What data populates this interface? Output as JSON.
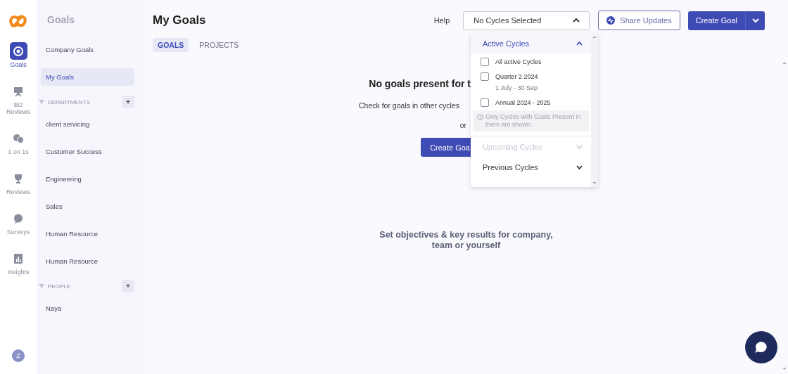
{
  "rail": {
    "items": [
      {
        "kind": "target",
        "label": "Goals",
        "selected": true
      },
      {
        "kind": "easel",
        "label": "Biz Reviews",
        "selected": false
      },
      {
        "kind": "chat",
        "label": "1 on 1s",
        "selected": false
      },
      {
        "kind": "trophy",
        "label": "Reviews",
        "selected": false
      },
      {
        "kind": "bubble",
        "label": "Surveys",
        "selected": false
      },
      {
        "kind": "chart",
        "label": "Insights",
        "selected": false
      }
    ],
    "avatar": "Z"
  },
  "sidebar": {
    "title": "Goals",
    "items": [
      {
        "label": "Company Goals",
        "selected": false
      },
      {
        "label": "My Goals",
        "selected": true
      }
    ],
    "sections": [
      {
        "title": "DEPARTMENTS",
        "add": "+",
        "expanded": true,
        "items": [
          "client servicing",
          "Customer Success",
          "Engineering",
          "Sales",
          "Human Resource",
          "Human Resource"
        ]
      },
      {
        "title": "PEOPLE",
        "add": "+",
        "expanded": true,
        "items": [
          "Naya"
        ]
      }
    ]
  },
  "header": {
    "title": "My Goals",
    "help": "Help",
    "cycle_select": "No Cycles Selected",
    "share_button": "Share Updates",
    "create_button": "Create Goal"
  },
  "tabs": [
    {
      "label": "GOALS",
      "selected": true
    },
    {
      "label": "PROJECTS",
      "selected": false
    }
  ],
  "empty_state": {
    "heading": "No goals present for t",
    "hint": "Check for goals in other cycles",
    "or": "or",
    "button": "Create Goa"
  },
  "tagline": "Set  objectives & key results for company, team or yourself",
  "cycle_dropdown": {
    "groups": [
      {
        "title": "Active Cycles",
        "expanded": true,
        "disabled": false,
        "options": [
          {
            "label": "All active Cycles",
            "checked": false
          },
          {
            "label": "Quarter 2 2024",
            "sub": "1 July - 30 Sep",
            "checked": false
          },
          {
            "label": "Annual 2024 - 2025",
            "checked": false
          }
        ],
        "note": "Only Cycles with Goals Present in them are shown."
      },
      {
        "title": "Upcoming Cycles",
        "expanded": false,
        "disabled": true
      },
      {
        "title": "Previous Cycles",
        "expanded": false,
        "disabled": false
      }
    ]
  }
}
